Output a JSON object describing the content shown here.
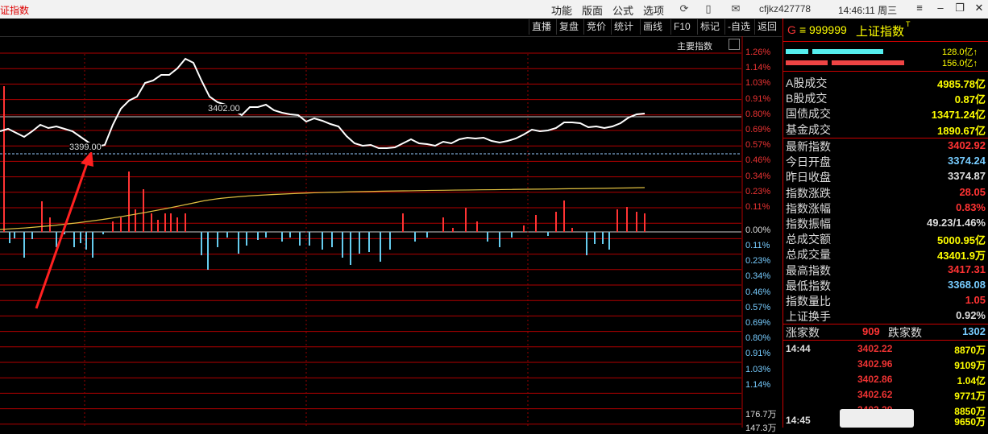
{
  "titlebar": {
    "title": "证指数",
    "menus": [
      "功能",
      "版面",
      "公式",
      "选项"
    ],
    "user": "cfjkz427778",
    "clock": "14:46:11 周三"
  },
  "toolbar": {
    "buttons": [
      "直播",
      "复盘",
      "竞价",
      "统计",
      "画线",
      "F10",
      "标记",
      "-自选",
      "返回"
    ]
  },
  "chart": {
    "main_label": "主要指数",
    "price_marker_high": "3402.00",
    "price_marker_low": "3399.00",
    "pct_labels_top": [
      "1.26%",
      "1.14%",
      "1.03%",
      "0.91%",
      "0.80%",
      "0.69%",
      "0.57%",
      "0.46%",
      "0.34%",
      "0.23%",
      "0.11%"
    ],
    "pct_zero": "0.00%",
    "pct_labels_bottom": [
      "0.11%",
      "0.23%",
      "0.34%",
      "0.46%",
      "0.57%",
      "0.69%",
      "0.80%",
      "0.91%",
      "1.03%",
      "1.14%"
    ],
    "volume_labels": [
      "176.7万",
      "147.3万"
    ],
    "colors": {
      "line": "#ffffff",
      "avg_line": "#e0c040",
      "up_bar": "#ff3333",
      "down_bar": "#66ccee",
      "grid": "#b00000",
      "arrow": "#ff2020"
    }
  },
  "quote": {
    "flag": "G",
    "code": "≡ 999999",
    "name": "上证指数",
    "sup": "T",
    "amount_up": "128.0亿↑",
    "amount_down": "156.0亿↑",
    "rows1": [
      {
        "label": "A股成交",
        "value": "4985.78亿",
        "color": "yellow"
      },
      {
        "label": "B股成交",
        "value": "0.87亿",
        "color": "yellow"
      },
      {
        "label": "国债成交",
        "value": "13471.24亿",
        "color": "yellow"
      },
      {
        "label": "基金成交",
        "value": "1890.67亿",
        "color": "yellow"
      }
    ],
    "rows2": [
      {
        "label": "最新指数",
        "value": "3402.92",
        "color": "red"
      },
      {
        "label": "今日开盘",
        "value": "3374.24",
        "color": "cyan"
      },
      {
        "label": "昨日收盘",
        "value": "3374.87",
        "color": "white"
      },
      {
        "label": "指数涨跌",
        "value": "28.05",
        "color": "red"
      },
      {
        "label": "指数涨幅",
        "value": "0.83%",
        "color": "red"
      },
      {
        "label": "指数振幅",
        "value": "49.23/1.46%",
        "color": "white"
      },
      {
        "label": "总成交额",
        "value": "5000.95亿",
        "color": "yellow"
      },
      {
        "label": "总成交量",
        "value": "43401.9万",
        "color": "yellow"
      },
      {
        "label": "最高指数",
        "value": "3417.31",
        "color": "red"
      },
      {
        "label": "最低指数",
        "value": "3368.08",
        "color": "cyan"
      },
      {
        "label": "指数量比",
        "value": "1.05",
        "color": "red"
      },
      {
        "label": "上证换手",
        "value": "0.92%",
        "color": "white"
      }
    ],
    "breadth": {
      "up_label": "涨家数",
      "up_value": "909",
      "down_label": "跌家数",
      "down_value": "1302"
    },
    "ticks": [
      {
        "time": "14:44",
        "price": "3402.22",
        "vol": "8870万"
      },
      {
        "time": "",
        "price": "3402.96",
        "vol": "9109万"
      },
      {
        "time": "",
        "price": "3402.86",
        "vol": "1.04亿"
      },
      {
        "time": "",
        "price": "3402.62",
        "vol": "9771万"
      },
      {
        "time": "",
        "price": "3402.29",
        "vol": "8850万"
      },
      {
        "time": "14:45",
        "price": "",
        "vol": "9650万"
      }
    ]
  }
}
